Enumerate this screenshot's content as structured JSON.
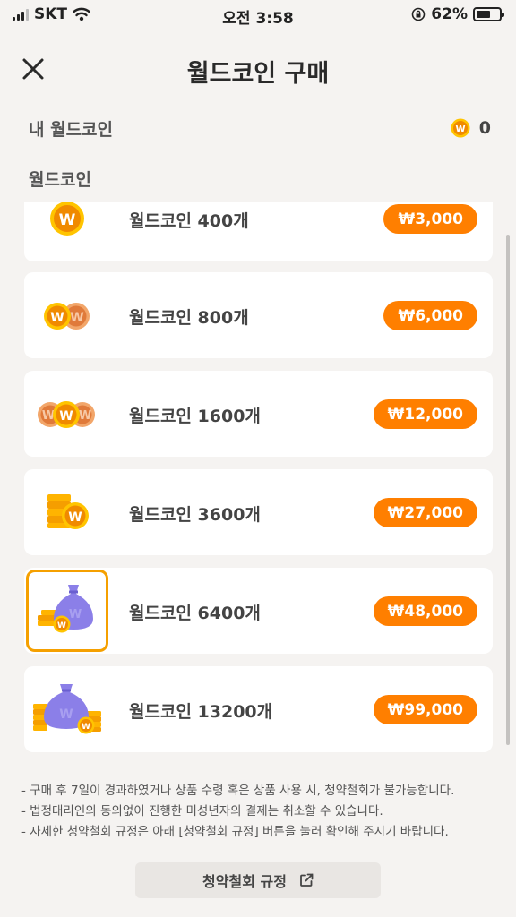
{
  "status": {
    "carrier": "SKT",
    "time": "오전 3:58",
    "battery": "62%",
    "battery_level": 0.62
  },
  "header": {
    "title": "월드코인 구매"
  },
  "balance": {
    "label": "내 월드코인",
    "value": "0"
  },
  "section": {
    "label": "월드코인"
  },
  "products": [
    {
      "name": "월드코인 400개",
      "price": "₩3,000"
    },
    {
      "name": "월드코인 800개",
      "price": "₩6,000"
    },
    {
      "name": "월드코인 1600개",
      "price": "₩12,000"
    },
    {
      "name": "월드코인 3600개",
      "price": "₩27,000"
    },
    {
      "name": "월드코인 6400개",
      "price": "₩48,000"
    },
    {
      "name": "월드코인 13200개",
      "price": "₩99,000"
    }
  ],
  "coin_letter": "W",
  "notes": [
    "- 구매 후 7일이 경과하였거나 상품 수령 혹은 상품 사용 시, 청약철회가 불가능합니다.",
    "- 법정대리인의 동의없이 진행한 미성년자의 결제는 취소할 수 있습니다.",
    "- 자세한 청약철회 규정은 아래 [청약철회 규정] 버튼을 눌러 확인해 주시기 바랍니다."
  ],
  "policy_button": {
    "label": "청약철회 규정"
  },
  "colors": {
    "accent": "#ff7f00",
    "coin": "#f5a000",
    "bag": "#8b7fe8",
    "selected_border": "#f5a000"
  }
}
